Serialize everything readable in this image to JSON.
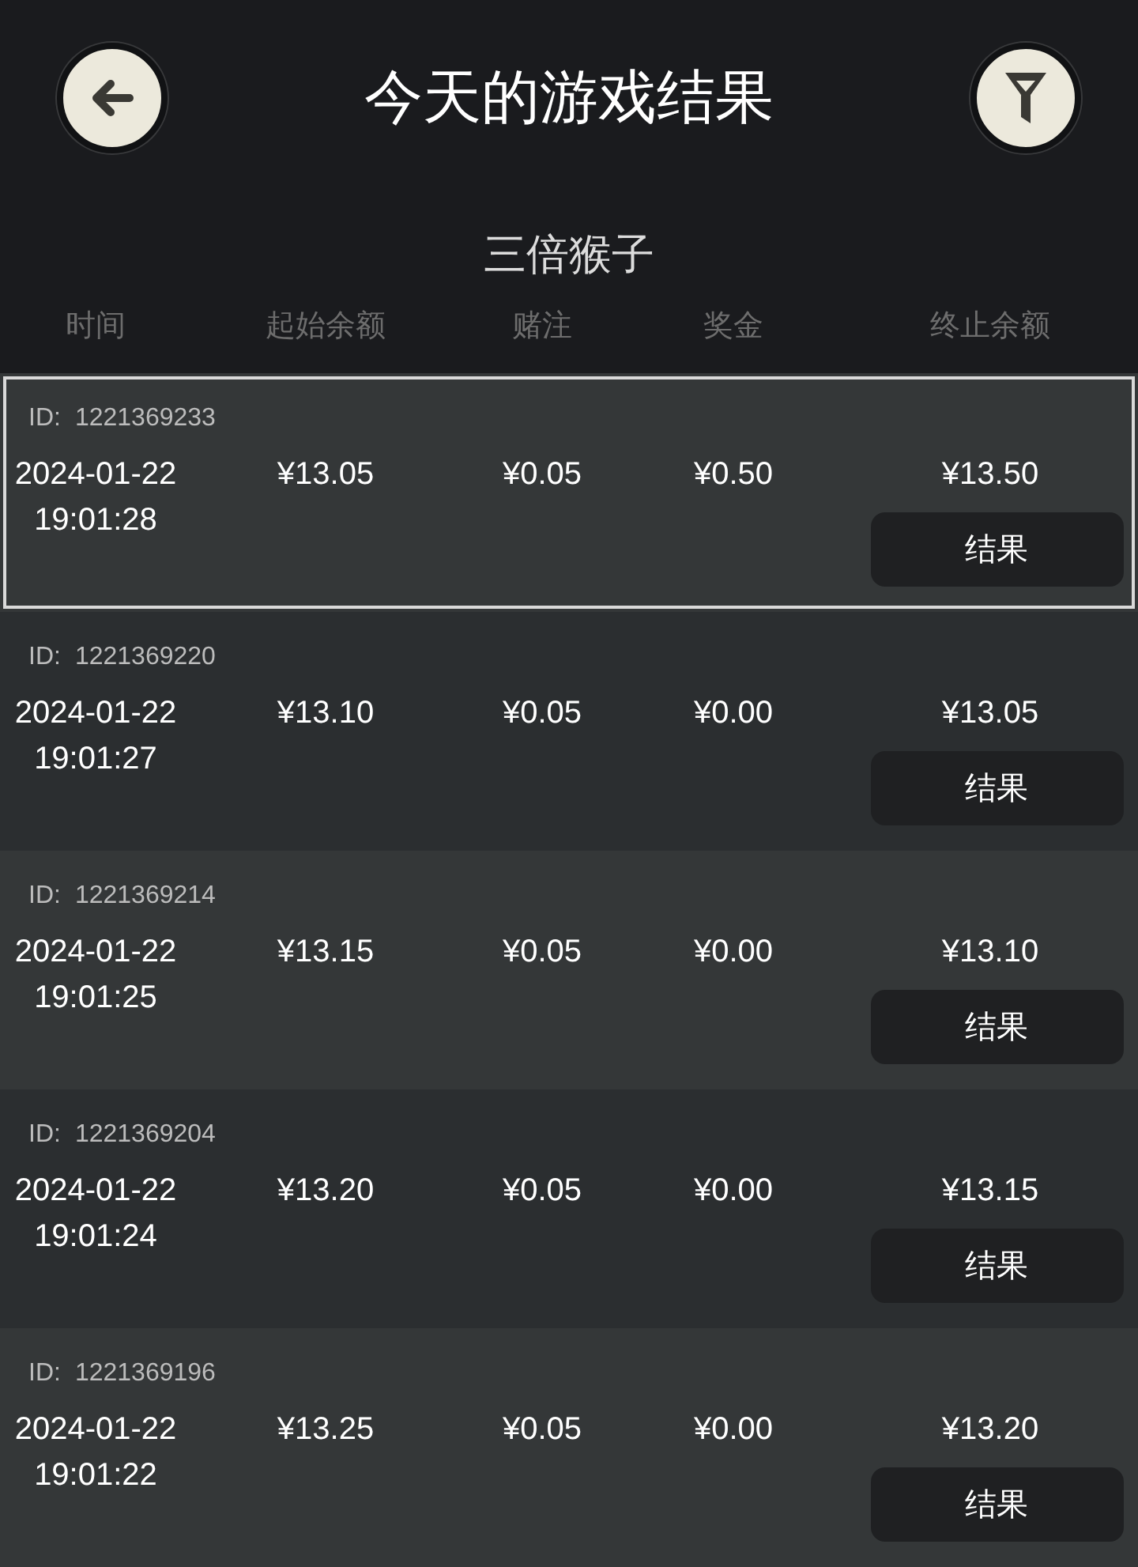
{
  "header": {
    "title": "今天的游戏结果"
  },
  "game_name": "三倍猴子",
  "columns": [
    "时间",
    "起始余额",
    "赌注",
    "奖金",
    "终止余额"
  ],
  "rows": [
    {
      "id_label": "ID:",
      "id": "1221369233",
      "date": "2024-01-22",
      "time": "19:01:28",
      "start_balance": "¥13.05",
      "bet": "¥0.05",
      "prize": "¥0.50",
      "end_balance": "¥13.50",
      "button": "结果",
      "selected": true
    },
    {
      "id_label": "ID:",
      "id": "1221369220",
      "date": "2024-01-22",
      "time": "19:01:27",
      "start_balance": "¥13.10",
      "bet": "¥0.05",
      "prize": "¥0.00",
      "end_balance": "¥13.05",
      "button": "结果",
      "selected": false
    },
    {
      "id_label": "ID:",
      "id": "1221369214",
      "date": "2024-01-22",
      "time": "19:01:25",
      "start_balance": "¥13.15",
      "bet": "¥0.05",
      "prize": "¥0.00",
      "end_balance": "¥13.10",
      "button": "结果",
      "selected": false
    },
    {
      "id_label": "ID:",
      "id": "1221369204",
      "date": "2024-01-22",
      "time": "19:01:24",
      "start_balance": "¥13.20",
      "bet": "¥0.05",
      "prize": "¥0.00",
      "end_balance": "¥13.15",
      "button": "结果",
      "selected": false
    },
    {
      "id_label": "ID:",
      "id": "1221369196",
      "date": "2024-01-22",
      "time": "19:01:22",
      "start_balance": "¥13.25",
      "bet": "¥0.05",
      "prize": "¥0.00",
      "end_balance": "¥13.20",
      "button": "结果",
      "selected": false
    }
  ]
}
